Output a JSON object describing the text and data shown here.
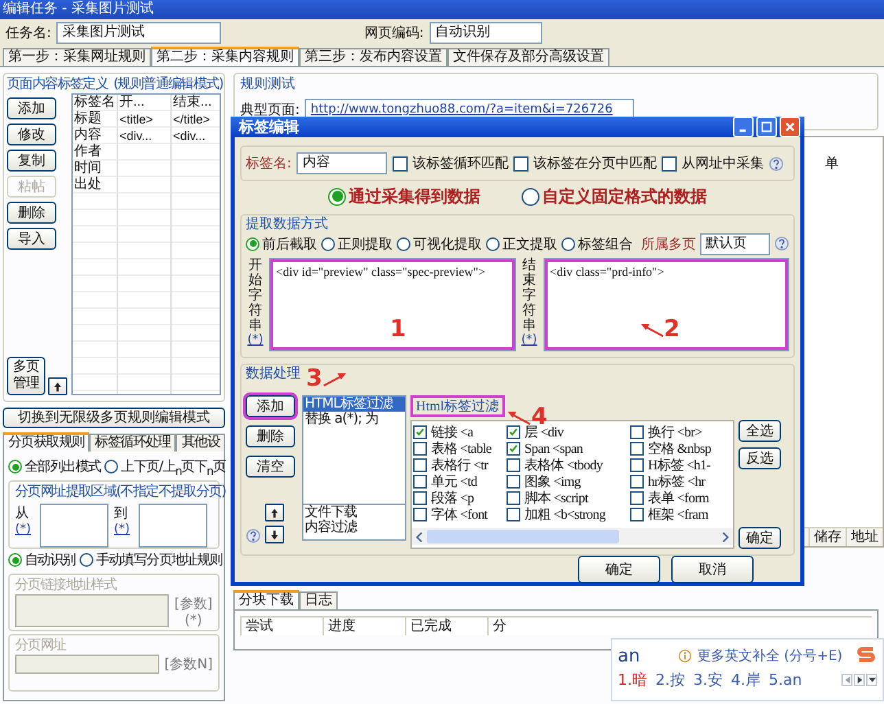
{
  "window": {
    "title": "编辑任务 - 采集图片测试"
  },
  "task": {
    "label": "任务名:",
    "value": "采集图片测试",
    "encoding_label": "网页编码:",
    "encoding": "自动识别"
  },
  "steps": [
    {
      "label": "第一步：采集网址规则",
      "selected": false
    },
    {
      "label": "第二步：采集内容规则",
      "selected": true
    },
    {
      "label": "第三步：发布内容设置",
      "selected": false
    },
    {
      "label": "文件保存及部分高级设置",
      "selected": false
    }
  ],
  "tag_definition": {
    "title": "页面内容标签定义",
    "mode": "(规则普通编辑模式)",
    "buttons": [
      {
        "label": "添加",
        "disabled": false
      },
      {
        "label": "修改",
        "disabled": false
      },
      {
        "label": "复制",
        "disabled": false
      },
      {
        "label": "粘帖",
        "disabled": true
      },
      {
        "label": "删除",
        "disabled": false
      },
      {
        "label": "导入",
        "disabled": false
      }
    ],
    "columns": [
      "标签名",
      "开...",
      "结束..."
    ],
    "rows": [
      {
        "name": "标题",
        "start": "<title>",
        "end": "</title>"
      },
      {
        "name": "内容",
        "start": "<div...",
        "end": "<div..."
      },
      {
        "name": "作者"
      },
      {
        "name": "时间"
      },
      {
        "name": "出处"
      }
    ],
    "multipage_button": "多页管理"
  },
  "switch_button": "切换到无限级多页规则编辑模式",
  "page_tabs": [
    {
      "label": "分页获取规则",
      "selected": true
    },
    {
      "label": "标签循环处理",
      "selected": false
    },
    {
      "label": "其他设",
      "selected": false
    }
  ],
  "list_mode": [
    {
      "label": "全部列出模式",
      "selected": true
    },
    {
      "label": "上下页/上$_{n}$页下$_{n}$页",
      "selected": false
    }
  ],
  "page_area": {
    "title": "分页网址提取区域(不指定不提取分页)",
    "from": "从",
    "to": "到",
    "from_link": "(*)",
    "to_link": "(*)"
  },
  "recognition": [
    {
      "label": "自动识别",
      "selected": true
    },
    {
      "label": "手动填写分页地址规则",
      "selected": false
    }
  ],
  "link_style": {
    "title": "分页链接地址样式",
    "param": "[参数]",
    "link": "(*)",
    "disabled": true
  },
  "page_url": {
    "title": "分页网址",
    "param": "[参数N]",
    "disabled": true
  },
  "rule_test": {
    "title": "规则测试",
    "page_label": "典型页面:",
    "url": "http://www.tongzhuo88.com/?a=item&i=726726",
    "side_text": "单",
    "columns": [
      "储存",
      "地址"
    ]
  },
  "download_tabs": [
    {
      "label": "分块下载",
      "selected": true
    },
    {
      "label": "日志",
      "selected": false
    }
  ],
  "download_columns": [
    "尝试",
    "进度",
    "已完成",
    "分"
  ],
  "dialog": {
    "title": "标签编辑",
    "name_label": "标签名:",
    "name": "内容",
    "options": [
      {
        "label": "该标签循环匹配",
        "checked": false
      },
      {
        "label": "该标签在分页中匹配",
        "checked": false
      },
      {
        "label": "从网址中采集",
        "checked": false
      }
    ],
    "source": [
      {
        "label": "通过采集得到数据",
        "selected": true
      },
      {
        "label": "自定义固定格式的数据",
        "selected": false
      }
    ],
    "extract": {
      "title": "提取数据方式",
      "methods": [
        {
          "label": "前后截取",
          "selected": true
        },
        {
          "label": "正则提取",
          "selected": false
        },
        {
          "label": "可视化提取",
          "selected": false
        },
        {
          "label": "正文提取",
          "selected": false
        },
        {
          "label": "标签组合",
          "selected": false
        }
      ],
      "page_label": "所属多页",
      "page": "默认页",
      "start": {
        "label": "开始字符串",
        "value": "<div id=\"preview\" class=\"spec-preview\">",
        "link": "(*)",
        "highlighted": true,
        "annotation": "1",
        "arrow": false
      },
      "end": {
        "label": "结束字符串",
        "value": "<div class=\"prd-info\">",
        "link": "(*)",
        "highlighted": true,
        "annotation": "2",
        "arrow": true
      }
    },
    "processing": {
      "title": "数据处理",
      "buttons": [
        {
          "label": "添加",
          "highlighted": true,
          "annotation": "3",
          "arrow": true
        },
        {
          "label": "删除",
          "highlighted": false
        },
        {
          "label": "清空",
          "highlighted": false
        }
      ],
      "steps": [
        {
          "label": "HTML标签过滤",
          "selected": true
        },
        {
          "label": "替换 a(*); 为",
          "selected": false
        }
      ],
      "extras": [
        "文件下载",
        "内容过滤"
      ]
    },
    "filter": {
      "title": "Html标签过滤",
      "highlighted": true,
      "annotation": "4",
      "arrow": true,
      "tags": [
        {
          "label": "链接 <a",
          "checked": true
        },
        {
          "label": "表格 <table",
          "checked": false
        },
        {
          "label": "表格行 <tr",
          "checked": false
        },
        {
          "label": "单元 <td",
          "checked": false
        },
        {
          "label": "段落 <p",
          "checked": false
        },
        {
          "label": "字体 <font",
          "checked": false
        },
        {
          "label": "层 <div",
          "checked": true
        },
        {
          "label": "Span <span",
          "checked": true
        },
        {
          "label": "表格体 <tbody",
          "checked": false
        },
        {
          "label": "图象 <img",
          "checked": false
        },
        {
          "label": "脚本 <script",
          "checked": false
        },
        {
          "label": "加粗 <b<strong",
          "checked": false
        },
        {
          "label": "换行 <br>",
          "checked": false
        },
        {
          "label": "空格 &nbsp",
          "checked": false
        },
        {
          "label": "H标签 <h1-",
          "checked": false
        },
        {
          "label": "hr标签 <hr",
          "checked": false
        },
        {
          "label": "表单 <form",
          "checked": false
        },
        {
          "label": "框架 <fram",
          "checked": false
        }
      ],
      "buttons": [
        "全选",
        "反选"
      ],
      "confirm": "确定"
    },
    "buttons": [
      "确定",
      "取消"
    ]
  },
  "ime": {
    "input": "an",
    "hint": "更多英文补全 (分号+E)",
    "candidates": [
      {
        "text": "1.暗",
        "selected": true
      },
      {
        "text": "2.按",
        "selected": false
      },
      {
        "text": "3.安",
        "selected": false
      },
      {
        "text": "4.岸",
        "selected": false
      },
      {
        "text": "5.an",
        "selected": false
      }
    ]
  }
}
